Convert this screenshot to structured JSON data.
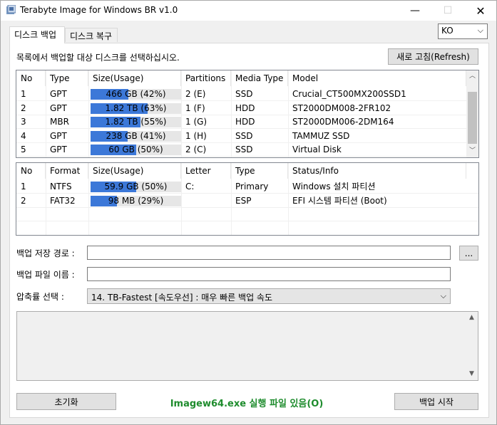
{
  "window": {
    "title": "Terabyte Image for Windows BR v1.0",
    "minimize": "—",
    "maximize": "☐",
    "close": "✕"
  },
  "tabs": [
    {
      "label": "디스크 백업",
      "active": true
    },
    {
      "label": "디스크 복구",
      "active": false
    }
  ],
  "language": {
    "value": "KO",
    "icon": "chevron-down"
  },
  "instruction": "목록에서 백업할 대상 디스크를 선택하십시오.",
  "refresh_button": "새로 고침(Refresh)",
  "disk_table": {
    "headers": [
      "No",
      "Type",
      "Size(Usage)",
      "Partitions",
      "Media Type",
      "Model"
    ],
    "rows": [
      {
        "no": "1",
        "type": "GPT",
        "size": "466 GB (42%)",
        "usage": 0.42,
        "partitions": "2 (E)",
        "media": "SSD",
        "model": "Crucial_CT500MX200SSD1"
      },
      {
        "no": "2",
        "type": "GPT",
        "size": "1.82 TB (63%)",
        "usage": 0.63,
        "partitions": "1 (F)",
        "media": "HDD",
        "model": "ST2000DM008-2FR102"
      },
      {
        "no": "3",
        "type": "MBR",
        "size": "1.82 TB (55%)",
        "usage": 0.55,
        "partitions": "1 (G)",
        "media": "HDD",
        "model": "ST2000DM006-2DM164"
      },
      {
        "no": "4",
        "type": "GPT",
        "size": "238 GB (41%)",
        "usage": 0.41,
        "partitions": "1 (H)",
        "media": "SSD",
        "model": "TAMMUZ SSD"
      },
      {
        "no": "5",
        "type": "GPT",
        "size": "60 GB (50%)",
        "usage": 0.5,
        "partitions": "2 (C)",
        "media": "SSD",
        "model": "Virtual Disk"
      }
    ]
  },
  "partition_table": {
    "headers": [
      "No",
      "Format",
      "Size(Usage)",
      "Letter",
      "Type",
      "Status/Info"
    ],
    "rows": [
      {
        "no": "1",
        "format": "NTFS",
        "size": "59.9 GB (50%)",
        "usage": 0.5,
        "letter": "C:",
        "type": "Primary",
        "status": "Windows 설치 파티션"
      },
      {
        "no": "2",
        "format": "FAT32",
        "size": "98 MB (29%)",
        "usage": 0.29,
        "letter": "",
        "type": "ESP",
        "status": "EFI 시스템 파티션 (Boot)"
      }
    ]
  },
  "backup_path": {
    "label": "백업 저장 경로 :",
    "value": "",
    "browse": "..."
  },
  "backup_filename": {
    "label": "백업 파일 이름 :",
    "value": ""
  },
  "compression": {
    "label": "압축률 선택 :",
    "value": "14. TB-Fastest [속도우선] : 매우 빠른 백업 속도"
  },
  "reset_button": "초기화",
  "status_text": "Imagew64.exe 실행 파일 있음(O)",
  "start_button": "백업 시작",
  "colors": {
    "usage_bar": "#3c78d8",
    "status_text": "#1e8c2d"
  }
}
